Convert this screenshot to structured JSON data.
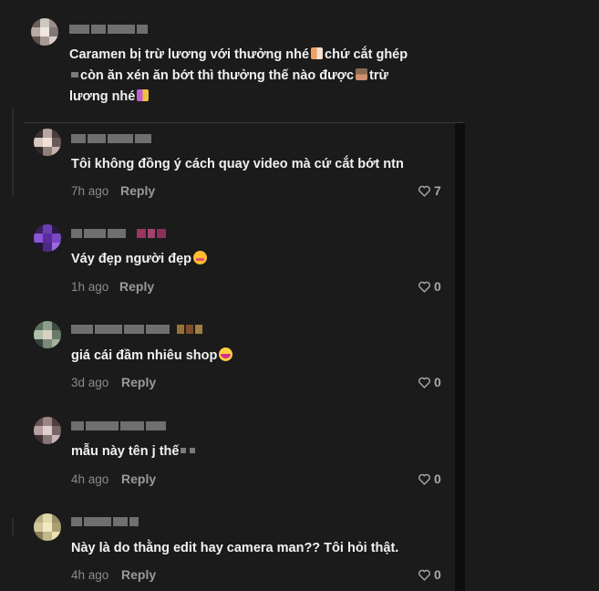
{
  "comments": [
    {
      "text_parts": [
        "Caramen bị trừ lương với thưởng nhé",
        "chứ cắt ghép",
        "còn ăn xén ăn bớt thì thưởng thế nào được",
        "trừ",
        "lương nhé"
      ],
      "time": "",
      "reply": "",
      "likes": ""
    },
    {
      "text": "Tôi không đồng ý cách quay video mà cứ cắt bớt ntn",
      "time": "7h ago",
      "reply": "Reply",
      "likes": "7"
    },
    {
      "text": "Váy đẹp người đẹp",
      "time": "1h ago",
      "reply": "Reply",
      "likes": "0"
    },
    {
      "text": "giá cái đầm nhiêu shop",
      "time": "3d ago",
      "reply": "Reply",
      "likes": "0"
    },
    {
      "text": "mẫu này tên j thế",
      "time": "4h ago",
      "reply": "Reply",
      "likes": "0"
    },
    {
      "text": "Này là do thằng edit hay camera man?? Tôi hỏi thật.",
      "time": "4h ago",
      "reply": "Reply",
      "likes": "0"
    }
  ],
  "icons": {
    "like": "heart-outline-icon"
  },
  "colors": {
    "background": "#1b1b1b",
    "text": "#f1f1f1",
    "meta": "#8a8a8a"
  }
}
